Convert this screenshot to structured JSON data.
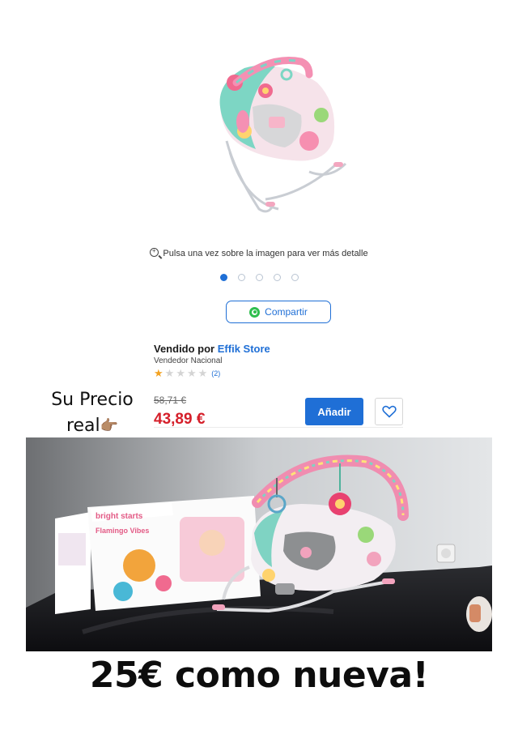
{
  "product": {
    "image_label": "Flamingo bouncer product image",
    "zoom_hint": "Pulsa una vez sobre la imagen para ver más detalle",
    "carousel": {
      "total": 5,
      "active": 1
    },
    "share_label": "Compartir"
  },
  "seller": {
    "prefix": "Vendido por",
    "name": "Effik Store",
    "type": "Vendedor Nacional",
    "rating_stars": 1,
    "rating_max": 5,
    "rating_count": "(2)"
  },
  "pricing": {
    "old_price": "58,71 €",
    "price": "43,89 €",
    "add_label": "Añadir"
  },
  "note": {
    "line1": "Su Precio",
    "line2": "real",
    "hand": "👉🏽"
  },
  "photo": {
    "box_brand": "bright starts",
    "box_product": "Flamingo Vibes"
  },
  "caption": "25€ como nueva!",
  "colors": {
    "accent": "#1f6fd6",
    "price_red": "#d51f2a",
    "whatsapp": "#2fbe4e"
  }
}
